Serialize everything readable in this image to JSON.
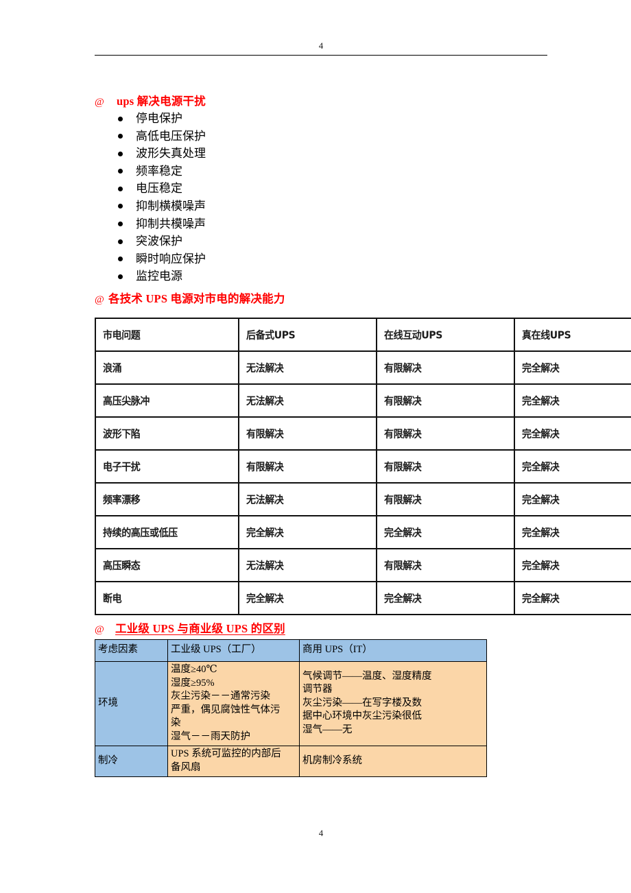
{
  "document": {
    "header_page_number": "4",
    "footer_page_number": "4"
  },
  "headings": {
    "at_symbol": "@",
    "h1": "ups 解决电源干扰",
    "h2": "各技术 UPS 电源对市电的解决能力",
    "h3": "工业级 UPS 与商业级 UPS 的区别",
    "color": "#ff0000"
  },
  "bullet_list": {
    "items": [
      "停电保护",
      "高低电压保护",
      "波形失真处理",
      "频率稳定",
      "电压稳定",
      "抑制横模噪声",
      "抑制共模噪声",
      "突波保护",
      "瞬时响应保护",
      "监控电源"
    ]
  },
  "table_capability": {
    "headers": [
      "市电问题",
      "后备式UPS",
      "在线互动UPS",
      "真在线UPS"
    ],
    "rows": [
      [
        "浪涌",
        "无法解决",
        "有限解决",
        "完全解决"
      ],
      [
        "高压尖脉冲",
        "无法解决",
        "有限解决",
        "完全解决"
      ],
      [
        "波形下陷",
        "有限解决",
        "有限解决",
        "完全解决"
      ],
      [
        "电子干扰",
        "有限解决",
        "有限解决",
        "完全解决"
      ],
      [
        "频率漂移",
        "无法解决",
        "有限解决",
        "完全解决"
      ],
      [
        "持续的高压或低压",
        "完全解决",
        "完全解决",
        "完全解决"
      ],
      [
        "高压瞬态",
        "无法解决",
        "有限解决",
        "完全解决"
      ],
      [
        "断电",
        "完全解决",
        "完全解决",
        "完全解决"
      ]
    ]
  },
  "table_comparison": {
    "header_bg": "#9dc3e6",
    "body_bg": "#fbd6a8",
    "headers": [
      "考虑因素",
      "工业级 UPS（工厂）",
      "商用 UPS（IT）"
    ],
    "rows": [
      {
        "label": "环境",
        "industrial": [
          "温度≥40℃",
          "湿度≥95%",
          "灰尘污染－－通常污染",
          "严重，偶见腐蚀性气体污",
          "染",
          "湿气－－雨天防护"
        ],
        "commercial": [
          "气候调节——温度、湿度精度",
          "调节器",
          "灰尘污染——在写字楼及数",
          "据中心环境中灰尘污染很低",
          "湿气——无"
        ]
      },
      {
        "label": "制冷",
        "industrial": [
          "UPS 系统可监控的内部后",
          "备风扇"
        ],
        "commercial": [
          "机房制冷系统"
        ]
      }
    ]
  }
}
